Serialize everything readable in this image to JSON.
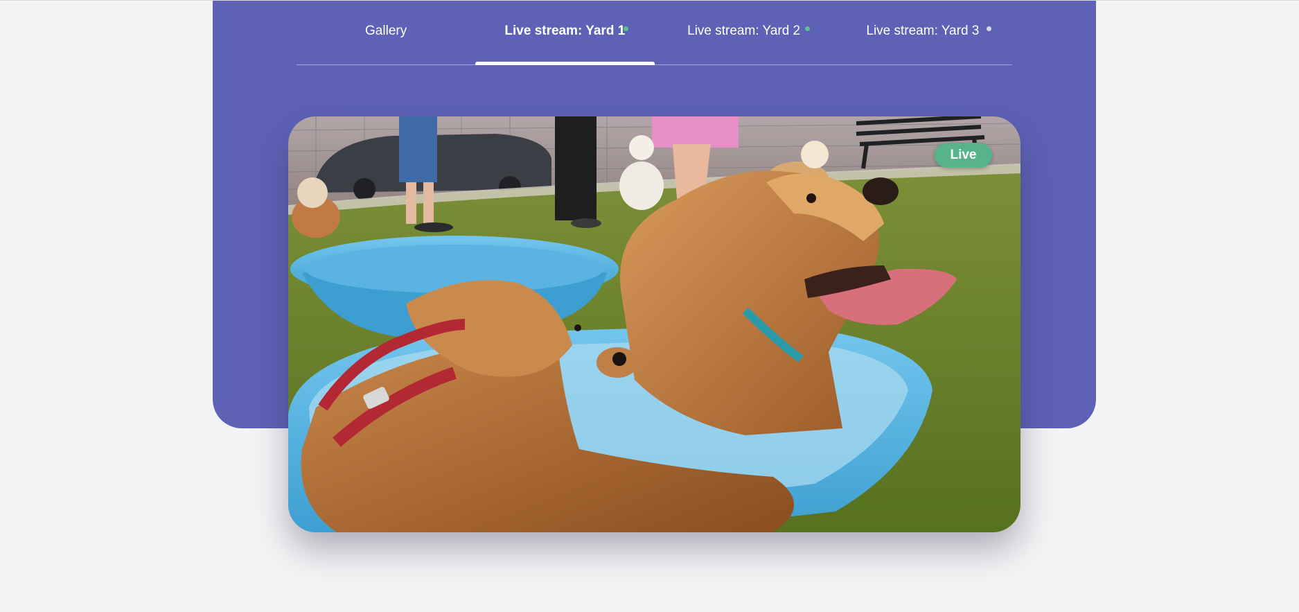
{
  "tabs": [
    {
      "label": "Gallery",
      "active": false,
      "status": "none"
    },
    {
      "label": "Live stream: Yard 1",
      "active": true,
      "status": "online"
    },
    {
      "label": "Live stream: Yard 2",
      "active": false,
      "status": "online"
    },
    {
      "label": "Live stream: Yard 3",
      "active": false,
      "status": "offline"
    }
  ],
  "video": {
    "badge": "Live",
    "subject": "dogs-in-paddling-pools-photo"
  },
  "colors": {
    "hero_background": "#5d62b7",
    "page_background": "#f4f4f6",
    "live_badge": "#56b38a",
    "status_online": "#5fbf8f",
    "status_offline": "#d8d8e6"
  }
}
